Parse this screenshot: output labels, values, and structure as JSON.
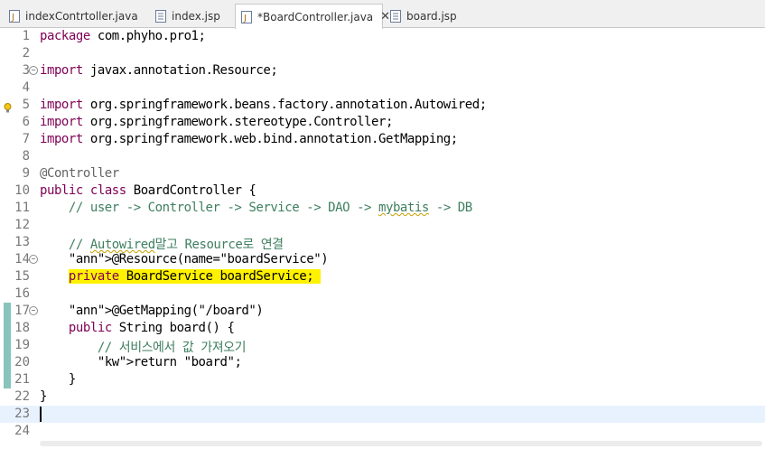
{
  "tabs": [
    {
      "label": "indexContrtoller.java",
      "icon": "java-file-icon",
      "active": false
    },
    {
      "label": "index.jsp",
      "icon": "jsp-file-icon",
      "active": false
    },
    {
      "label": "*BoardController.java",
      "icon": "java-file-icon",
      "active": true,
      "close": "✕"
    },
    {
      "label": "board.jsp",
      "icon": "jsp-file-icon",
      "active": false
    }
  ],
  "lines": [
    {
      "n": "1",
      "text": "package com.phyho.pro1;"
    },
    {
      "n": "2",
      "text": ""
    },
    {
      "n": "3",
      "text": "import javax.annotation.Resource;"
    },
    {
      "n": "4",
      "text": ""
    },
    {
      "n": "5",
      "text": "import org.springframework.beans.factory.annotation.Autowired;"
    },
    {
      "n": "6",
      "text": "import org.springframework.stereotype.Controller;"
    },
    {
      "n": "7",
      "text": "import org.springframework.web.bind.annotation.GetMapping;"
    },
    {
      "n": "8",
      "text": ""
    },
    {
      "n": "9",
      "text": "@Controller"
    },
    {
      "n": "10",
      "text": "public class BoardController {"
    },
    {
      "n": "11",
      "text": "    // user -> Controller -> Service -> DAO -> mybatis -> DB"
    },
    {
      "n": "12",
      "text": ""
    },
    {
      "n": "13",
      "text": "    // Autowired말고 Resource로 연결"
    },
    {
      "n": "14",
      "text": "    @Resource(name=\"boardService\")"
    },
    {
      "n": "15",
      "text": "    private BoardService boardService;"
    },
    {
      "n": "16",
      "text": ""
    },
    {
      "n": "17",
      "text": "    @GetMapping(\"/board\")"
    },
    {
      "n": "18",
      "text": "    public String board() {"
    },
    {
      "n": "19",
      "text": "        // 서비스에서 값 가져오기"
    },
    {
      "n": "20",
      "text": "        return \"board\";"
    },
    {
      "n": "21",
      "text": "    }"
    },
    {
      "n": "22",
      "text": "}"
    },
    {
      "n": "23",
      "text": ""
    },
    {
      "n": "24",
      "text": ""
    }
  ],
  "colors": {
    "keyword": "#7f0055",
    "string": "#2a00ff",
    "comment": "#3f7f5f",
    "annotation": "#646464",
    "highlight": "#fff200",
    "current_line": "#e8f2fe",
    "change_marker": "#5fb2a6"
  }
}
